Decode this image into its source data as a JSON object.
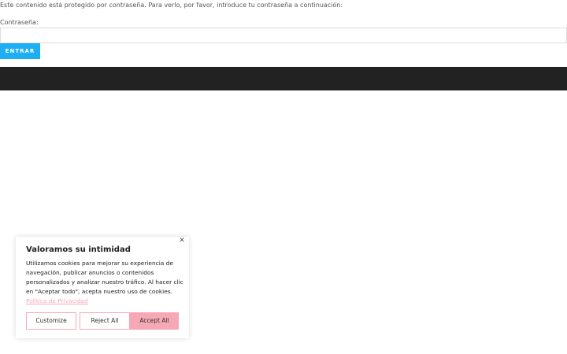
{
  "password_form": {
    "message": "Este contenido está protegido por contraseña. Para verlo, por favor, introduce tu contraseña a continuación:",
    "label": "Contraseña:",
    "input_value": "",
    "submit_label": "ENTRAR"
  },
  "cookie_banner": {
    "title": "Valoramos su intimidad",
    "close_icon": "close-icon",
    "body": "Utilizamos cookies para mejorar su experiencia de navegación, publicar anuncios o contenidos personalizados y analizar nuestro tráfico. Al hacer clic en \"Aceptar todo\", acepta nuestro uso de cookies.",
    "privacy_link": "Política de Privacidad",
    "buttons": {
      "customize": "Customize",
      "reject": "Reject All",
      "accept": "Accept All"
    }
  },
  "colors": {
    "submit_button": "#1eaef3",
    "footer_bar": "#222222",
    "cookie_accent": "#f7a8b5"
  }
}
